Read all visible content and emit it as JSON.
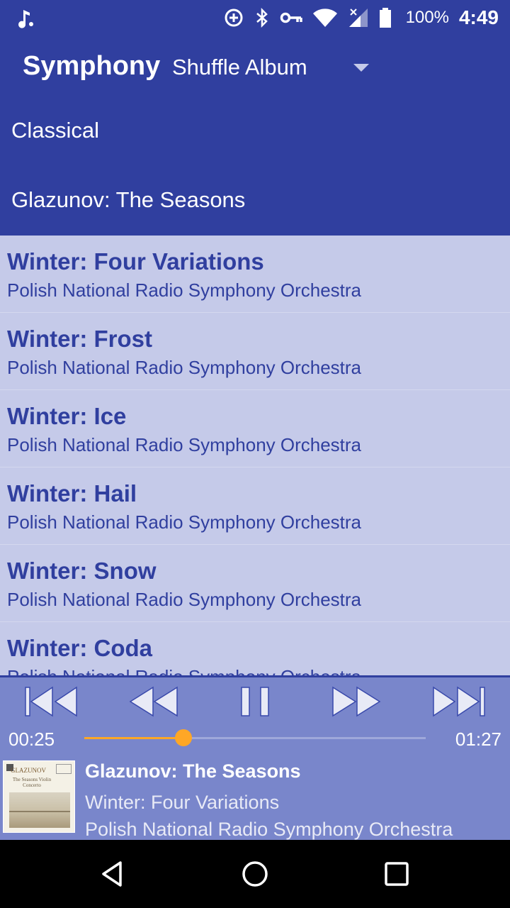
{
  "status_bar": {
    "left_icon": "music-app-notification-icon",
    "icons": [
      "data-saver-icon",
      "bluetooth-icon",
      "vpn-key-icon",
      "wifi-icon",
      "cell-signal-icon",
      "battery-icon"
    ],
    "battery": "100%",
    "time": "4:49"
  },
  "app_bar": {
    "title": "Symphony",
    "mode_selector": {
      "selected": "Shuffle Album",
      "icon": "dropdown-arrow-icon"
    },
    "genre": "Classical",
    "album": "Glazunov: The Seasons"
  },
  "tracks": [
    {
      "title": "Winter: Four Variations",
      "artist": "Polish National Radio Symphony Orchestra"
    },
    {
      "title": "Winter: Frost",
      "artist": "Polish National Radio Symphony Orchestra"
    },
    {
      "title": "Winter: Ice",
      "artist": "Polish National Radio Symphony Orchestra"
    },
    {
      "title": "Winter: Hail",
      "artist": "Polish National Radio Symphony Orchestra"
    },
    {
      "title": "Winter: Snow",
      "artist": "Polish National Radio Symphony Orchestra"
    },
    {
      "title": "Winter: Coda",
      "artist": "Polish National Radio Symphony Orchestra"
    }
  ],
  "player": {
    "controls": [
      "skip-previous-icon",
      "rewind-icon",
      "pause-icon",
      "fast-forward-icon",
      "skip-next-icon"
    ],
    "current_time": "00:25",
    "total_time": "01:27",
    "progress_fraction": 0.29,
    "accent_color": "#ffa726",
    "now_playing": {
      "album": "Glazunov: The Seasons",
      "track": "Winter: Four Variations",
      "artist": "Polish National Radio Symphony Orchestra"
    },
    "album_art": {
      "title": "GLAZUNOV",
      "subtitle": "The Seasons Violin Concerto"
    }
  },
  "nav_bar": {
    "buttons": [
      "back-icon",
      "home-icon",
      "recents-icon"
    ]
  },
  "colors": {
    "primary": "#303f9f",
    "list_background": "#c5cae9",
    "player_background": "#7986cb"
  }
}
